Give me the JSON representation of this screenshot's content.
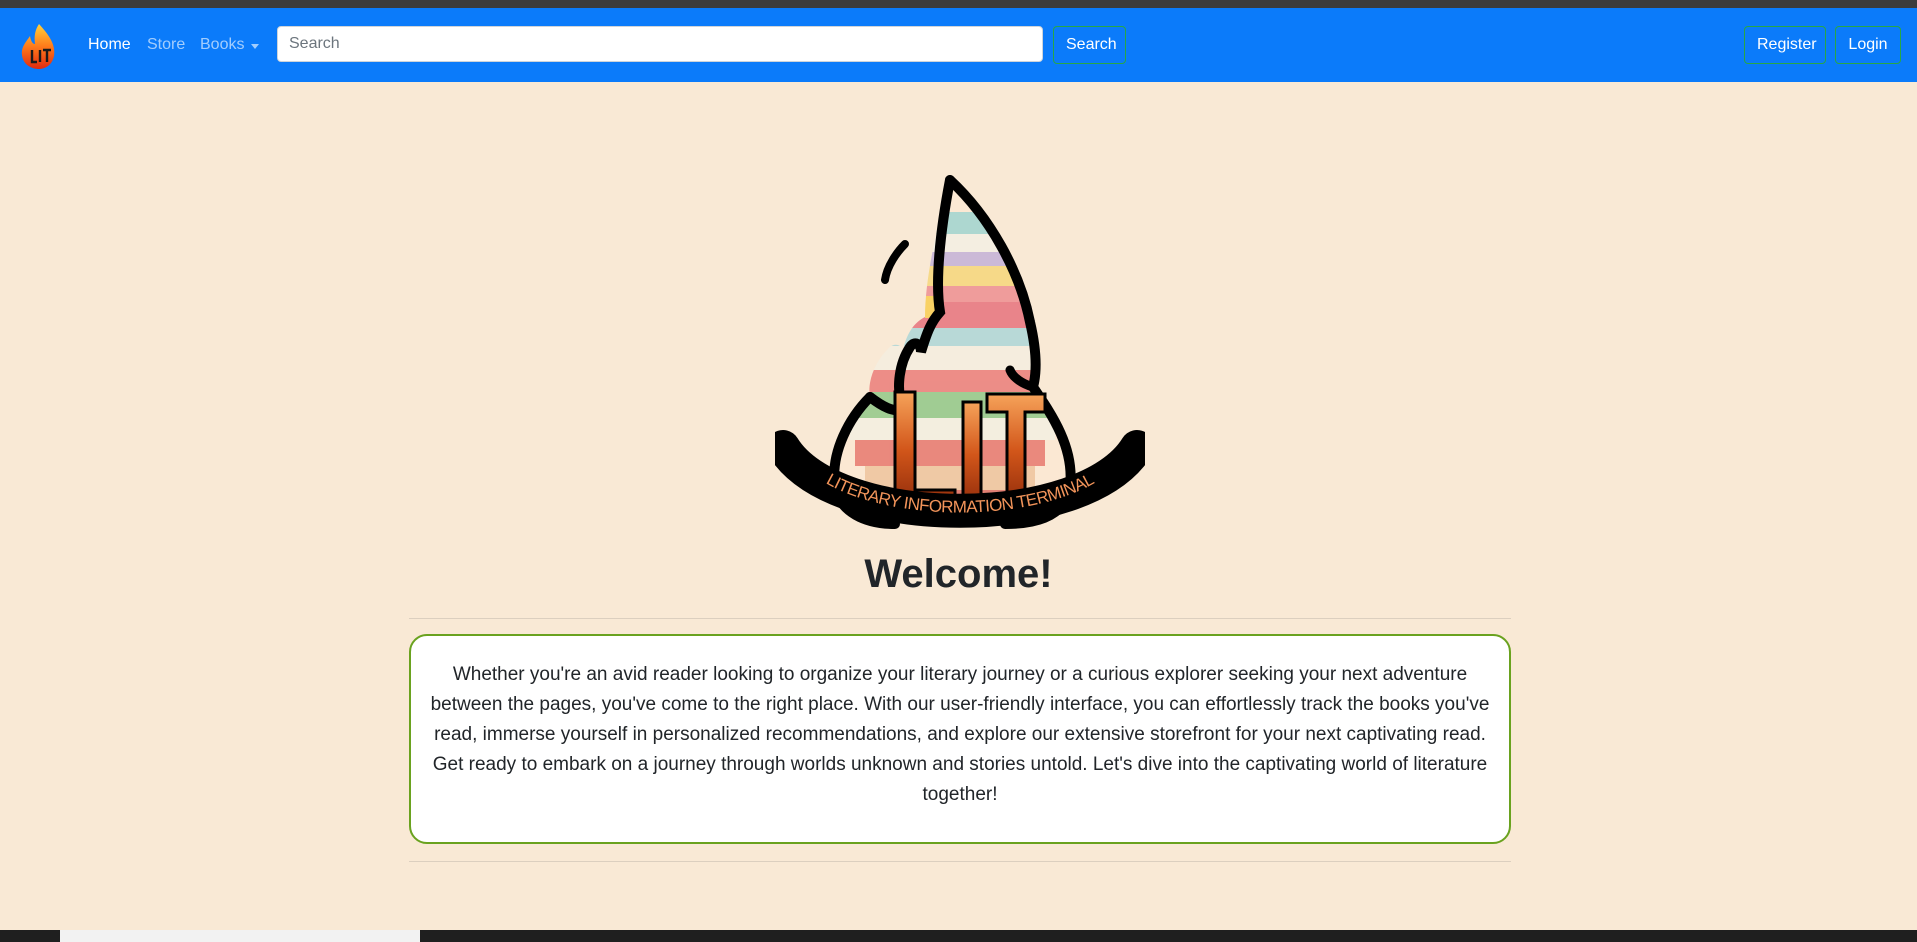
{
  "nav": {
    "brand_logo": "lit-flame-logo",
    "links": [
      {
        "label": "Home",
        "active": true
      },
      {
        "label": "Store",
        "active": false
      },
      {
        "label": "Books",
        "active": false,
        "dropdown": true
      }
    ],
    "search": {
      "placeholder": "Search",
      "value": "",
      "button_label": "Search"
    },
    "register_label": "Register",
    "login_label": "Login"
  },
  "hero": {
    "logo_text": "LIT",
    "logo_subtitle": "LITERARY INFORMATION TERMINAL",
    "heading": "Welcome!",
    "intro": "Whether you're an avid reader looking to organize your literary journey or a curious explorer seeking your next adventure between the pages, you've come to the right place. With our user-friendly interface, you can effortlessly track the books you've read, immerse yourself in personalized recommendations, and explore our extensive storefront for your next captivating read. Get ready to embark on a journey through worlds unknown and stories untold. Let's dive into the captivating world of literature together!"
  },
  "colors": {
    "navbar": "#0b7bfa",
    "page_background": "#f9e9d5",
    "card_border": "#6aa21f",
    "button_border": "#28a745"
  }
}
